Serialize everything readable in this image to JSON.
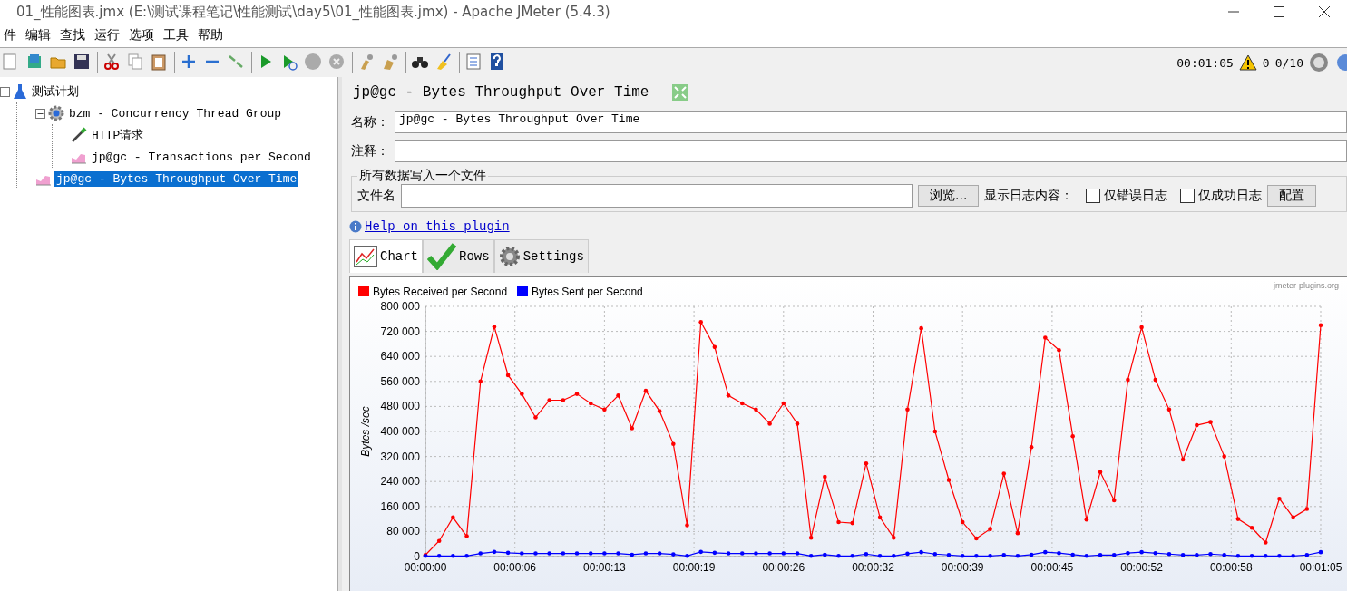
{
  "window": {
    "title": "01_性能图表.jmx (E:\\测试课程笔记\\性能测试\\day5\\01_性能图表.jmx) - Apache JMeter (5.4.3)"
  },
  "menu": [
    "件",
    "编辑",
    "查找",
    "运行",
    "选项",
    "工具",
    "帮助"
  ],
  "status": {
    "elapsed": "00:01:05",
    "warnings": "0",
    "threads": "0/10"
  },
  "tree": [
    {
      "label": "测试计划",
      "kind": "plan",
      "selected": false,
      "expanded": true,
      "children": [
        {
          "label": "bzm - Concurrency Thread Group",
          "kind": "group",
          "selected": false,
          "expanded": true,
          "children": [
            {
              "label": "HTTP请求",
              "kind": "sampler",
              "selected": false
            },
            {
              "label": "jp@gc - Transactions per Second",
              "kind": "graph",
              "selected": false
            }
          ]
        },
        {
          "label": "jp@gc - Bytes Throughput Over Time",
          "kind": "graph",
          "selected": true
        }
      ]
    }
  ],
  "panel": {
    "title": "jp@gc - Bytes Throughput Over Time",
    "name_label": "名称：",
    "name_value": "jp@gc - Bytes Throughput Over Time",
    "comment_label": "注释：",
    "file_group": "所有数据写入一个文件",
    "file_label": "文件名",
    "browse": "浏览...",
    "log_label": "显示日志内容：",
    "checks": [
      {
        "label": "仅错误日志",
        "checked": false
      },
      {
        "label": "仅成功日志",
        "checked": false
      }
    ],
    "config": "配置",
    "help_link": "Help on this plugin",
    "tabs": [
      {
        "label": "Chart",
        "selected": true
      },
      {
        "label": "Rows",
        "selected": false
      },
      {
        "label": "Settings",
        "selected": false
      }
    ],
    "credit": "jmeter-plugins.org",
    "chart_data": {
      "type": "line",
      "grid": true,
      "legend": true,
      "ylabel": "Bytes /sec",
      "xlim": [
        0,
        65
      ],
      "ylim": [
        0,
        800000
      ],
      "x": [
        0,
        1,
        2,
        3,
        4,
        5,
        6,
        7,
        8,
        9,
        10,
        11,
        12,
        13,
        14,
        15,
        16,
        17,
        18,
        19,
        20,
        21,
        22,
        23,
        24,
        25,
        26,
        27,
        28,
        29,
        30,
        31,
        32,
        33,
        34,
        35,
        36,
        37,
        38,
        39,
        40,
        41,
        42,
        43,
        44,
        45,
        46,
        47,
        48,
        49,
        50,
        51,
        52,
        53,
        54,
        55,
        56,
        57,
        58,
        59,
        60,
        61,
        62,
        63,
        64,
        65
      ],
      "yticks": [
        {
          "value": 0,
          "label": "0"
        },
        {
          "value": 80000,
          "label": "80 000"
        },
        {
          "value": 160000,
          "label": "160 000"
        },
        {
          "value": 240000,
          "label": "240 000"
        },
        {
          "value": 320000,
          "label": "320 000"
        },
        {
          "value": 400000,
          "label": "400 000"
        },
        {
          "value": 480000,
          "label": "480 000"
        },
        {
          "value": 560000,
          "label": "560 000"
        },
        {
          "value": 640000,
          "label": "640 000"
        },
        {
          "value": 720000,
          "label": "720 000"
        },
        {
          "value": 800000,
          "label": "800 000"
        }
      ],
      "xticks": [
        {
          "value": 0,
          "label": "00:00:00"
        },
        {
          "value": 6.5,
          "label": "00:00:06"
        },
        {
          "value": 13,
          "label": "00:00:13"
        },
        {
          "value": 19.5,
          "label": "00:00:19"
        },
        {
          "value": 26,
          "label": "00:00:26"
        },
        {
          "value": 32.5,
          "label": "00:00:32"
        },
        {
          "value": 39,
          "label": "00:00:39"
        },
        {
          "value": 45.5,
          "label": "00:00:45"
        },
        {
          "value": 52,
          "label": "00:00:52"
        },
        {
          "value": 58.5,
          "label": "00:00:58"
        },
        {
          "value": 65,
          "label": "00:01:05"
        }
      ],
      "series": [
        {
          "name": "Bytes Received per Second",
          "color": "#ff0000",
          "values": [
            5000,
            50000,
            125000,
            65000,
            560000,
            735000,
            580000,
            520000,
            445000,
            500000,
            500000,
            520000,
            490000,
            470000,
            515000,
            410000,
            530000,
            465000,
            360000,
            100000,
            750000,
            670000,
            515000,
            490000,
            470000,
            425000,
            490000,
            425000,
            60000,
            255000,
            110000,
            107000,
            298000,
            125000,
            60000,
            470000,
            730000,
            400000,
            245000,
            110000,
            58000,
            88000,
            265000,
            75000,
            350000,
            700000,
            660000,
            385000,
            118000,
            270000,
            180000,
            565000,
            733000,
            565000,
            470000,
            310000,
            420000,
            430000,
            320000,
            120000,
            92000,
            45000,
            185000,
            125000,
            152000,
            740000
          ]
        },
        {
          "name": "Bytes Sent per Second",
          "color": "#0000ff",
          "values": [
            2000,
            2000,
            2000,
            2000,
            10000,
            15000,
            12000,
            10000,
            10000,
            10000,
            10000,
            10000,
            10000,
            10000,
            10000,
            6000,
            10000,
            10000,
            7000,
            2000,
            15000,
            12000,
            10000,
            10000,
            10000,
            10000,
            10000,
            10000,
            2000,
            6000,
            2000,
            2000,
            8000,
            2000,
            2000,
            9000,
            14000,
            8000,
            5000,
            2000,
            2000,
            2000,
            5000,
            2000,
            6000,
            14000,
            11000,
            6000,
            2000,
            5000,
            5000,
            11000,
            14000,
            11000,
            8000,
            5000,
            5000,
            8000,
            5000,
            2000,
            2000,
            2000,
            2000,
            2000,
            5000,
            14000
          ]
        }
      ]
    }
  }
}
